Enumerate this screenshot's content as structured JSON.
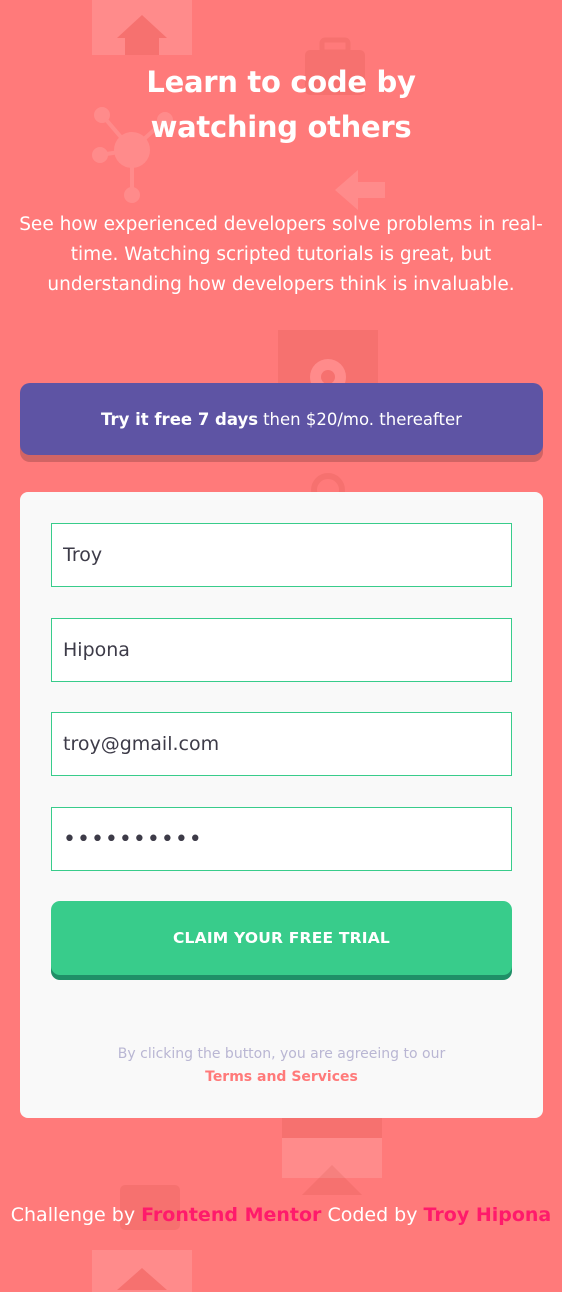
{
  "colors": {
    "background": "#ff7a7a",
    "banner": "#5e54a4",
    "accent_green": "#38cc8b",
    "link_pink": "#ff1a6b",
    "card": "#f9f9f9"
  },
  "hero": {
    "title_line1": "Learn to code by",
    "title_line2": "watching others",
    "description": "See how experienced developers solve problems in real-time. Watching scripted tutorials is great, but understanding how developers think is invaluable."
  },
  "offer": {
    "bold": "Try it free 7 days",
    "rest": "then $20/mo. thereafter"
  },
  "form": {
    "first_name": "Troy",
    "last_name": "Hipona",
    "email": "troy@gmail.com",
    "password": "••••••••••",
    "submit_label": "CLAIM YOUR FREE TRIAL",
    "terms_text": "By clicking the button, you are agreeing to our",
    "terms_link": "Terms and Services"
  },
  "footer": {
    "prefix": "Challenge by",
    "challenge_link": "Frontend Mentor",
    "middle": "Coded by",
    "author_link": "Troy Hipona"
  },
  "background_icons": [
    "home-icon",
    "briefcase-icon",
    "network-icon",
    "gear-icon",
    "search-icon",
    "laptop-icon",
    "arrow-icon"
  ]
}
